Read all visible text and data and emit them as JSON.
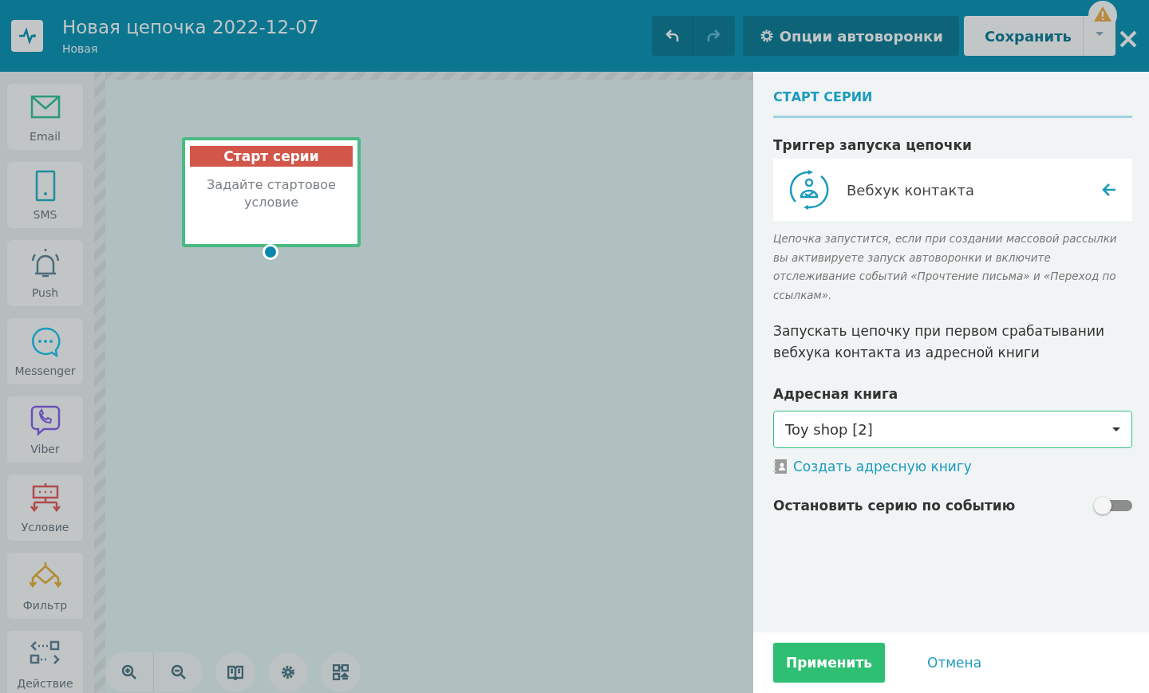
{
  "header": {
    "title": "Новая цепочка 2022-12-07",
    "subtitle": "Новая",
    "options_button": "Опции автоворонки",
    "save_button": "Сохранить",
    "warning": true,
    "redo_disabled": true
  },
  "palette": [
    {
      "kind": "email",
      "label": "Email"
    },
    {
      "kind": "sms",
      "label": "SMS"
    },
    {
      "kind": "push",
      "label": "Push"
    },
    {
      "kind": "messenger",
      "label": "Messenger"
    },
    {
      "kind": "viber",
      "label": "Viber"
    },
    {
      "kind": "condition",
      "label": "Условие"
    },
    {
      "kind": "filter",
      "label": "Фильтр"
    },
    {
      "kind": "action",
      "label": "Действие"
    }
  ],
  "canvas": {
    "node": {
      "title": "Старт серии",
      "text": "Задайте стартовое условие",
      "selected": true
    }
  },
  "panel": {
    "heading": "СТАРТ СЕРИИ",
    "trigger_label": "Триггер запуска цепочки",
    "trigger": "Вебхук контакта",
    "description": "Цепочка запустится, если при создании массовой рассылки вы активируете запуск автоворонки и включите отслеживание событий «Прочтение письма» и «Переход по ссылкам».",
    "summary": "Запускать цепочку при первом срабатывании вебхука контакта из адресной книги",
    "book_label": "Адресная книга",
    "book_value": "Toy shop [2]",
    "create_link": "Создать адресную книгу",
    "stop_label": "Остановить серию по событию",
    "stop_on": false,
    "apply_button": "Применить",
    "cancel_button": "Отмена"
  }
}
